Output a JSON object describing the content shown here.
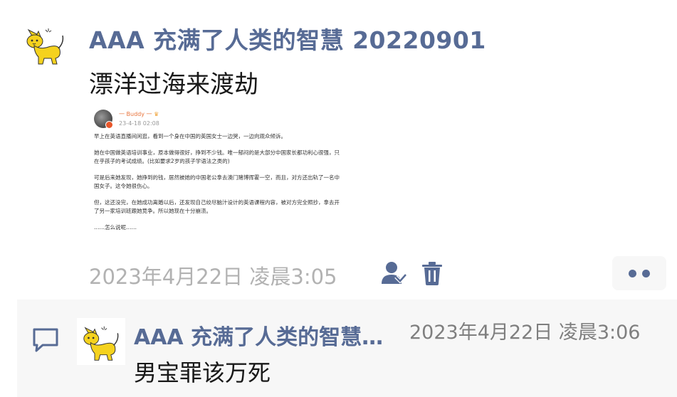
{
  "post": {
    "username": "AAA 充满了人类的智慧 20220901",
    "text": "漂洋过海来渡劫",
    "timestamp": "2023年4月22日 凌晨3:05",
    "avatar_icon": "yellow-cat-icon"
  },
  "embed": {
    "name": "一 Buddy 一",
    "crown": "♛",
    "date": "23-4-18 02:08",
    "paragraphs": [
      "早上在英语直播间闲逛，看到一个身在中国的英国女士一边哭，一边向观众倾诉。",
      "她在中国做英语培训事业，原本做得很好，挣到不少钱。唯一郁闷的是大部分中国家长都功利心很强，只在乎孩子的考试成绩。(比如要求2岁的孩子学语法之类的)",
      "可是后来她发现，她挣到的钱，居然被她的中国老公拿去澳门赌博挥霍一空，而且，对方还出轨了一名中国女子。这令她很伤心。",
      "但，这还没完，在她成功离婚以后，还发现自己绞尽脑汁设计的英语课程内容，被对方完全照抄，拿去开了另一家培训班跟她竞争。所以她现在十分崩溃。",
      "……怎么说呢……"
    ]
  },
  "actions": {
    "user_icon": "user-icon",
    "trash_icon": "trash-icon",
    "more_icon": "more-icon"
  },
  "comment": {
    "icon": "comment-icon",
    "name": "AAA 充满了人类的智慧 20220901",
    "time": "2023年4月22日 凌晨3:06",
    "text": "男宝罪该万死"
  },
  "colors": {
    "link": "#576b95",
    "meta": "#b2b2b2",
    "comment_bg": "#f7f7f7",
    "cat": "#f5d21e"
  }
}
